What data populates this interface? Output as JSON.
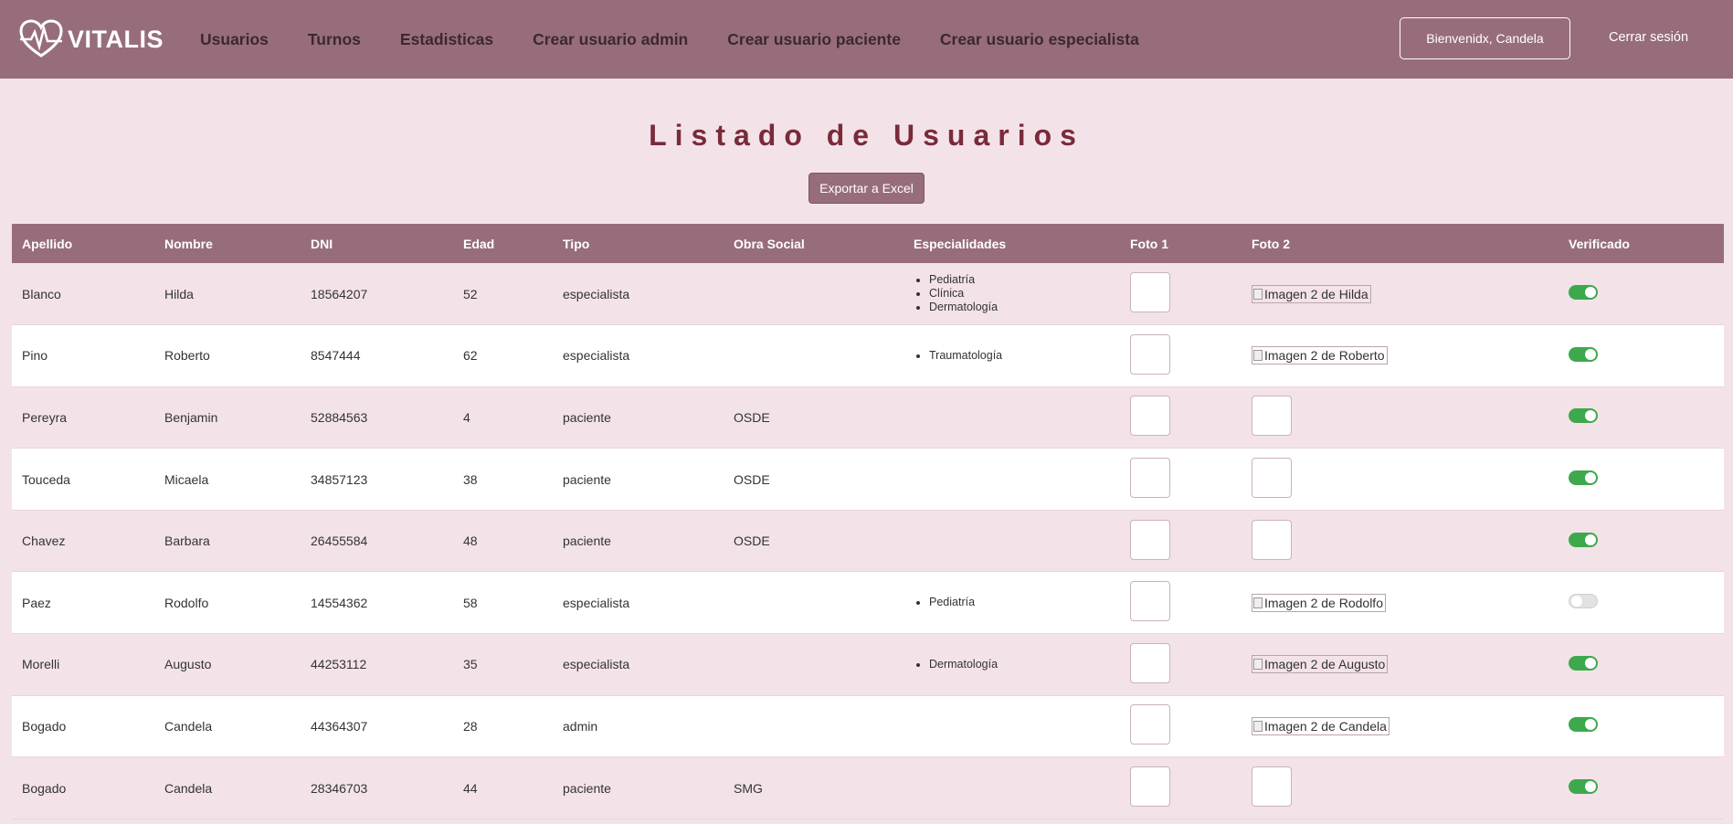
{
  "nav": {
    "logo_text": "VITALIS",
    "links": [
      "Usuarios",
      "Turnos",
      "Estadisticas",
      "Crear usuario admin",
      "Crear usuario paciente",
      "Crear usuario especialista"
    ],
    "welcome": "Bienvenidx, Candela",
    "logout": "Cerrar sesión"
  },
  "page": {
    "title": "Listado de Usuarios",
    "export_label": "Exportar a Excel"
  },
  "table": {
    "headers": [
      "Apellido",
      "Nombre",
      "DNI",
      "Edad",
      "Tipo",
      "Obra Social",
      "Especialidades",
      "Foto 1",
      "Foto 2",
      "Verificado"
    ],
    "rows": [
      {
        "apellido": "Blanco",
        "nombre": "Hilda",
        "dni": "18564207",
        "edad": "52",
        "tipo": "especialista",
        "obra": "",
        "esp": [
          "Pediatría",
          "Clínica",
          "Dermatología"
        ],
        "foto1": "#c46a1a",
        "foto2": "Imagen 2 de Hilda",
        "verificado": true
      },
      {
        "apellido": "Pino",
        "nombre": "Roberto",
        "dni": "8547444",
        "edad": "62",
        "tipo": "especialista",
        "obra": "",
        "esp": [
          "Traumatología"
        ],
        "foto1": "#4a4448",
        "foto2": "Imagen 2 de Roberto",
        "verificado": true
      },
      {
        "apellido": "Pereyra",
        "nombre": "Benjamin",
        "dni": "52884563",
        "edad": "4",
        "tipo": "paciente",
        "obra": "OSDE",
        "esp": [],
        "foto1": "#1e2d4a",
        "foto2": "#d9b7a0",
        "verificado": true
      },
      {
        "apellido": "Touceda",
        "nombre": "Micaela",
        "dni": "34857123",
        "edad": "38",
        "tipo": "paciente",
        "obra": "OSDE",
        "esp": [],
        "foto1": "#1c3c8a",
        "foto2": "#3a4440",
        "verificado": true
      },
      {
        "apellido": "Chavez",
        "nombre": "Barbara",
        "dni": "26455584",
        "edad": "48",
        "tipo": "paciente",
        "obra": "OSDE",
        "esp": [],
        "foto1": "#3a3a40",
        "foto2": "#d9b7a0",
        "verificado": true
      },
      {
        "apellido": "Paez",
        "nombre": "Rodolfo",
        "dni": "14554362",
        "edad": "58",
        "tipo": "especialista",
        "obra": "",
        "esp": [
          "Pediatría"
        ],
        "foto1": "#c46a1a",
        "foto2": "Imagen 2 de Rodolfo",
        "verificado": false
      },
      {
        "apellido": "Morelli",
        "nombre": "Augusto",
        "dni": "44253112",
        "edad": "35",
        "tipo": "especialista",
        "obra": "",
        "esp": [
          "Dermatología"
        ],
        "foto1": "#4a4448",
        "foto2": "Imagen 2 de Augusto",
        "verificado": true
      },
      {
        "apellido": "Bogado",
        "nombre": "Candela",
        "dni": "44364307",
        "edad": "28",
        "tipo": "admin",
        "obra": "",
        "esp": [],
        "foto1": "#3a4440",
        "foto2": "Imagen 2 de Candela",
        "verificado": true
      },
      {
        "apellido": "Bogado",
        "nombre": "Candela",
        "dni": "28346703",
        "edad": "44",
        "tipo": "paciente",
        "obra": "SMG",
        "esp": [],
        "foto1": "#4a2a4a",
        "foto2": "#20202a",
        "verificado": true
      }
    ]
  }
}
